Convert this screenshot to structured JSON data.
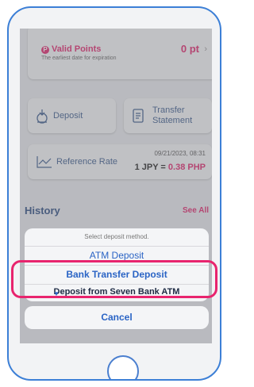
{
  "points": {
    "title": "Valid Points",
    "subtitle": "The earliest date for expiration",
    "value": "0 pt",
    "icon": "points-badge-icon"
  },
  "actions": {
    "deposit_label": "Deposit",
    "transfer_label_line1": "Transfer",
    "transfer_label_line2": "Statement"
  },
  "rate": {
    "label": "Reference Rate",
    "datetime": "09/21/2023, 08:31",
    "value_prefix": "1 JPY = ",
    "value_highlight": "0.38 PHP"
  },
  "history": {
    "title": "History",
    "see_all": "See All"
  },
  "sheet": {
    "header": "Select deposit method.",
    "options": [
      "ATM Deposit",
      "Bank Transfer Deposit",
      "Deposit from Seven Bank ATM"
    ],
    "cancel": "Cancel"
  },
  "colors": {
    "accent": "#e0246b",
    "link": "#2a64c5",
    "frame": "#3c7fd6",
    "highlight": "#e8246e"
  }
}
